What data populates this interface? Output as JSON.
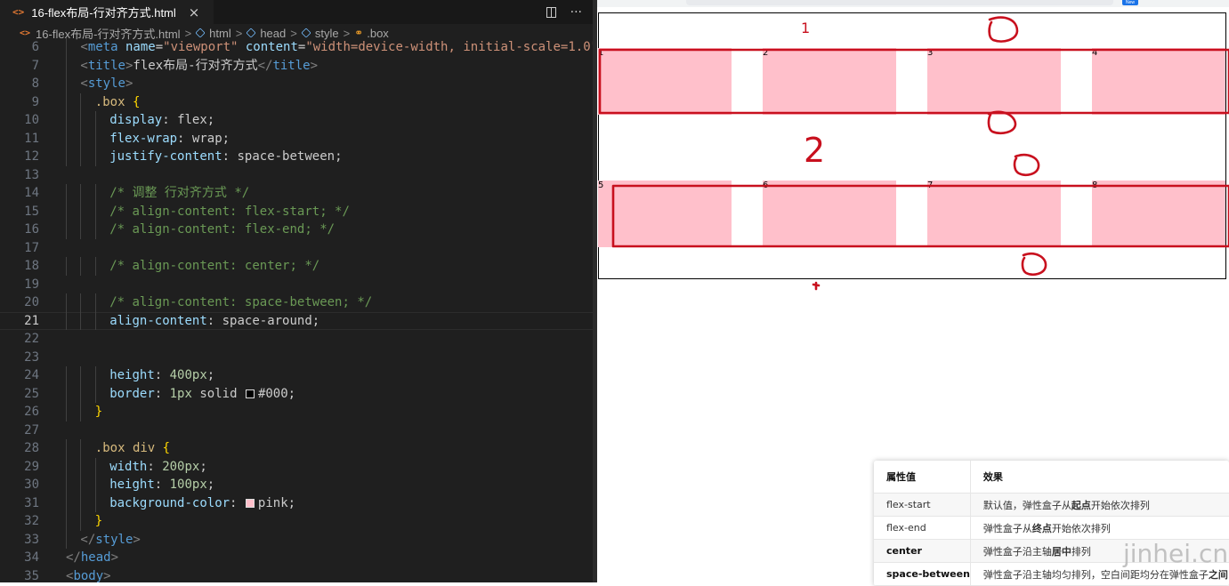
{
  "editor": {
    "tab": {
      "icon": "<>",
      "title": "16-flex布局-行对齐方式.html",
      "close": "×"
    },
    "tab_actions": {
      "more": "···"
    },
    "breadcrumb": {
      "file": "16-flex布局-行对齐方式.html",
      "items": [
        "html",
        "head",
        "style",
        ".box"
      ],
      "separator": ">"
    },
    "code_lines": [
      {
        "n": "6",
        "indent": 2,
        "segs": [
          [
            "t",
            "<"
          ],
          [
            "tg",
            "meta"
          ],
          [
            "pn",
            " "
          ],
          [
            "at",
            "name"
          ],
          [
            "pn",
            "="
          ],
          [
            "st",
            "\"viewport\""
          ],
          [
            "pn",
            " "
          ],
          [
            "at",
            "content"
          ],
          [
            "pn",
            "="
          ],
          [
            "st",
            "\"width=device-width, initial-scale=1.0\""
          ],
          [
            "t",
            ">"
          ]
        ]
      },
      {
        "n": "7",
        "indent": 2,
        "segs": [
          [
            "t",
            "<"
          ],
          [
            "tg",
            "title"
          ],
          [
            "t",
            ">"
          ],
          [
            "pn",
            "flex布局-行对齐方式"
          ],
          [
            "t",
            "</"
          ],
          [
            "tg",
            "title"
          ],
          [
            "t",
            ">"
          ]
        ]
      },
      {
        "n": "8",
        "indent": 2,
        "segs": [
          [
            "t",
            "<"
          ],
          [
            "tg",
            "style"
          ],
          [
            "t",
            ">"
          ]
        ]
      },
      {
        "n": "9",
        "indent": 4,
        "segs": [
          [
            "sl",
            ".box"
          ],
          [
            "pn",
            " "
          ],
          [
            "br",
            "{"
          ]
        ]
      },
      {
        "n": "10",
        "indent": 6,
        "segs": [
          [
            "pr",
            "display"
          ],
          [
            "pn",
            ": "
          ],
          [
            "vl",
            "flex"
          ],
          [
            "pn",
            ";"
          ]
        ]
      },
      {
        "n": "11",
        "indent": 6,
        "segs": [
          [
            "pr",
            "flex-wrap"
          ],
          [
            "pn",
            ": "
          ],
          [
            "vl",
            "wrap"
          ],
          [
            "pn",
            ";"
          ]
        ]
      },
      {
        "n": "12",
        "indent": 6,
        "segs": [
          [
            "pr",
            "justify-content"
          ],
          [
            "pn",
            ": "
          ],
          [
            "vl",
            "space-between"
          ],
          [
            "pn",
            ";"
          ]
        ]
      },
      {
        "n": "13",
        "indent": 0,
        "segs": []
      },
      {
        "n": "14",
        "indent": 6,
        "segs": [
          [
            "cm",
            "/* 调整 行对齐方式 */"
          ]
        ]
      },
      {
        "n": "15",
        "indent": 6,
        "segs": [
          [
            "cm",
            "/* align-content: flex-start; */"
          ]
        ]
      },
      {
        "n": "16",
        "indent": 6,
        "segs": [
          [
            "cm",
            "/* align-content: flex-end; */"
          ]
        ]
      },
      {
        "n": "17",
        "indent": 0,
        "segs": []
      },
      {
        "n": "18",
        "indent": 6,
        "segs": [
          [
            "cm",
            "/* align-content: center; */"
          ]
        ]
      },
      {
        "n": "19",
        "indent": 0,
        "segs": []
      },
      {
        "n": "20",
        "indent": 6,
        "segs": [
          [
            "cm",
            "/* align-content: space-between; */"
          ]
        ]
      },
      {
        "n": "21",
        "indent": 6,
        "segs": [
          [
            "pr",
            "align-content"
          ],
          [
            "pn",
            ": "
          ],
          [
            "vl",
            "space-around"
          ],
          [
            "pn",
            ";"
          ]
        ],
        "current": true
      },
      {
        "n": "22",
        "indent": 0,
        "segs": []
      },
      {
        "n": "23",
        "indent": 0,
        "segs": []
      },
      {
        "n": "24",
        "indent": 6,
        "segs": [
          [
            "pr",
            "height"
          ],
          [
            "pn",
            ": "
          ],
          [
            "nm",
            "400px"
          ],
          [
            "pn",
            ";"
          ]
        ]
      },
      {
        "n": "25",
        "indent": 6,
        "segs": [
          [
            "pr",
            "border"
          ],
          [
            "pn",
            ": "
          ],
          [
            "nm",
            "1px"
          ],
          [
            "pn",
            " "
          ],
          [
            "vl",
            "solid"
          ],
          [
            "pn",
            " "
          ],
          [
            "sw",
            "#000000"
          ],
          [
            "vl",
            "#000"
          ],
          [
            "pn",
            ";"
          ]
        ]
      },
      {
        "n": "26",
        "indent": 4,
        "segs": [
          [
            "br",
            "}"
          ]
        ]
      },
      {
        "n": "27",
        "indent": 0,
        "segs": []
      },
      {
        "n": "28",
        "indent": 4,
        "segs": [
          [
            "sl",
            ".box div"
          ],
          [
            "pn",
            " "
          ],
          [
            "br",
            "{"
          ]
        ]
      },
      {
        "n": "29",
        "indent": 6,
        "segs": [
          [
            "pr",
            "width"
          ],
          [
            "pn",
            ": "
          ],
          [
            "nm",
            "200px"
          ],
          [
            "pn",
            ";"
          ]
        ]
      },
      {
        "n": "30",
        "indent": 6,
        "segs": [
          [
            "pr",
            "height"
          ],
          [
            "pn",
            ": "
          ],
          [
            "nm",
            "100px"
          ],
          [
            "pn",
            ";"
          ]
        ]
      },
      {
        "n": "31",
        "indent": 6,
        "segs": [
          [
            "pr",
            "background-color"
          ],
          [
            "pn",
            ": "
          ],
          [
            "sw",
            "#ffc0cb"
          ],
          [
            "vl",
            "pink"
          ],
          [
            "pn",
            ";"
          ]
        ]
      },
      {
        "n": "32",
        "indent": 4,
        "segs": [
          [
            "br",
            "}"
          ]
        ]
      },
      {
        "n": "33",
        "indent": 2,
        "segs": [
          [
            "t",
            "</"
          ],
          [
            "tg",
            "style"
          ],
          [
            "t",
            ">"
          ]
        ]
      },
      {
        "n": "34",
        "indent": 0,
        "segs": [
          [
            "t",
            "</"
          ],
          [
            "tg",
            "head"
          ],
          [
            "t",
            ">"
          ]
        ]
      },
      {
        "n": "35",
        "indent": 0,
        "segs": [
          [
            "t",
            "<"
          ],
          [
            "tg",
            "body"
          ],
          [
            "t",
            ">"
          ]
        ]
      }
    ]
  },
  "browser": {
    "badge": "New",
    "items": [
      "1",
      "2",
      "3",
      "4",
      "5",
      "6",
      "7",
      "8"
    ],
    "annotations": {
      "row1": "1",
      "row2": "2"
    }
  },
  "reference_table": {
    "headers": [
      "属性值",
      "效果"
    ],
    "rows": [
      {
        "value": "flex-start",
        "bold": false,
        "effect": [
          "默认值，弹性盒子从",
          "起点",
          "开始依次排列"
        ]
      },
      {
        "value": "flex-end",
        "bold": false,
        "effect": [
          "弹性盒子从",
          "终点",
          "开始依次排列"
        ]
      },
      {
        "value": "center",
        "bold": true,
        "effect": [
          "弹性盒子沿主轴",
          "居中",
          "排列"
        ]
      },
      {
        "value": "space-between",
        "bold": true,
        "effect": [
          "弹性盒子沿主轴均匀排列，空白间距均分在弹性盒子",
          "之间",
          ""
        ]
      }
    ]
  },
  "watermark": "jinhei.cn",
  "colors": {
    "editor_bg": "#1f1f1f",
    "item_bg": "#ffc0cb",
    "annotation_red": "#c8101e"
  }
}
